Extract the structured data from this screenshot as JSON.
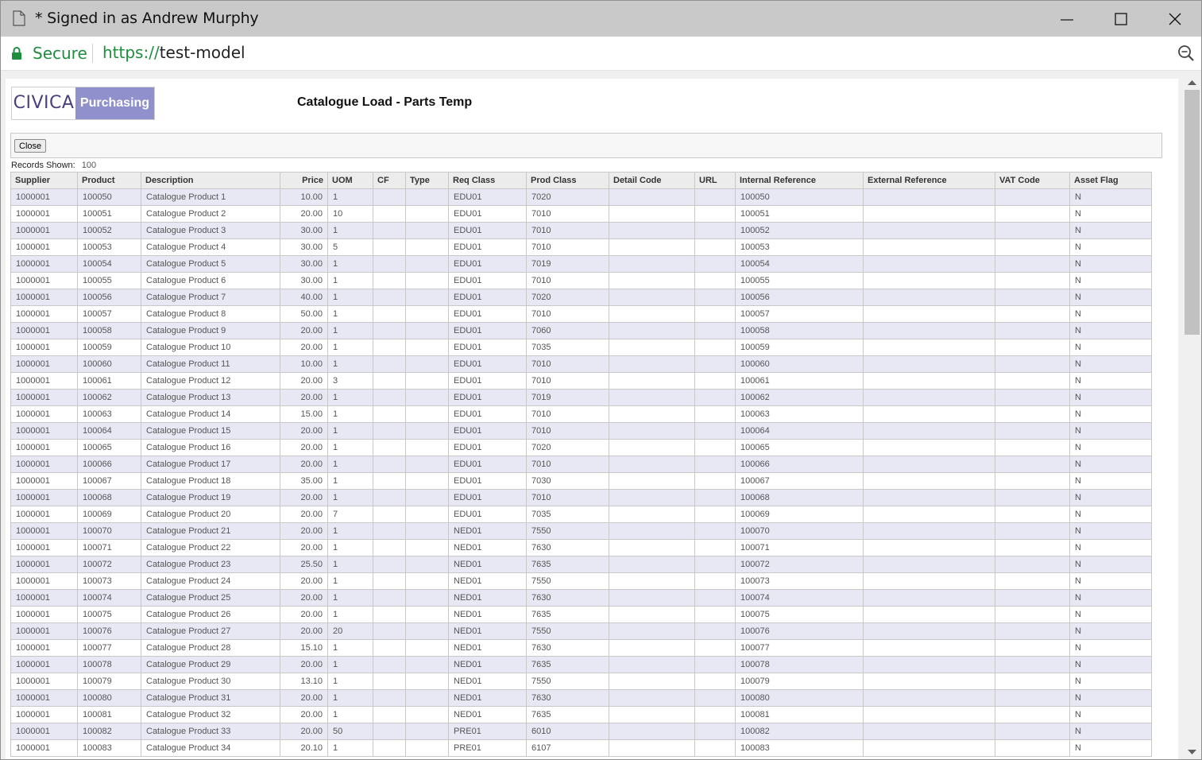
{
  "window": {
    "title": "* Signed in as Andrew Murphy",
    "icons": {
      "doc": "document-icon",
      "min": "minimize-icon",
      "max": "maximize-icon",
      "close": "close-icon"
    }
  },
  "address": {
    "secure_label": "Secure",
    "url_protocol": "https://",
    "url_host": "test-model",
    "icons": {
      "lock": "lock-icon",
      "zoom": "zoom-icon"
    }
  },
  "logo": {
    "brand": "CIVICA",
    "product": "Purchasing"
  },
  "page": {
    "title": "Catalogue Load - Parts Temp"
  },
  "toolbar": {
    "close_label": "Close"
  },
  "records": {
    "label": "Records Shown:",
    "count": "100"
  },
  "colors": {
    "row_alt": "#e8e8f5",
    "logo_purple": "#9090cc",
    "secure_green": "#1e8e3e"
  },
  "table": {
    "columns": [
      "Supplier",
      "Product",
      "Description",
      "Price",
      "UOM",
      "CF",
      "Type",
      "Req Class",
      "Prod Class",
      "Detail Code",
      "URL",
      "Internal Reference",
      "External Reference",
      "VAT Code",
      "Asset Flag"
    ],
    "rows": [
      [
        "1000001",
        "100050",
        "Catalogue Product 1",
        "10.00",
        "1",
        "",
        "",
        "EDU01",
        "7020",
        "",
        "",
        "100050",
        "",
        "",
        "N"
      ],
      [
        "1000001",
        "100051",
        "Catalogue Product 2",
        "20.00",
        "10",
        "",
        "",
        "EDU01",
        "7010",
        "",
        "",
        "100051",
        "",
        "",
        "N"
      ],
      [
        "1000001",
        "100052",
        "Catalogue Product 3",
        "30.00",
        "1",
        "",
        "",
        "EDU01",
        "7010",
        "",
        "",
        "100052",
        "",
        "",
        "N"
      ],
      [
        "1000001",
        "100053",
        "Catalogue Product 4",
        "30.00",
        "5",
        "",
        "",
        "EDU01",
        "7010",
        "",
        "",
        "100053",
        "",
        "",
        "N"
      ],
      [
        "1000001",
        "100054",
        "Catalogue Product 5",
        "30.00",
        "1",
        "",
        "",
        "EDU01",
        "7019",
        "",
        "",
        "100054",
        "",
        "",
        "N"
      ],
      [
        "1000001",
        "100055",
        "Catalogue Product 6",
        "30.00",
        "1",
        "",
        "",
        "EDU01",
        "7010",
        "",
        "",
        "100055",
        "",
        "",
        "N"
      ],
      [
        "1000001",
        "100056",
        "Catalogue Product 7",
        "40.00",
        "1",
        "",
        "",
        "EDU01",
        "7020",
        "",
        "",
        "100056",
        "",
        "",
        "N"
      ],
      [
        "1000001",
        "100057",
        "Catalogue Product 8",
        "50.00",
        "1",
        "",
        "",
        "EDU01",
        "7010",
        "",
        "",
        "100057",
        "",
        "",
        "N"
      ],
      [
        "1000001",
        "100058",
        "Catalogue Product 9",
        "20.00",
        "1",
        "",
        "",
        "EDU01",
        "7060",
        "",
        "",
        "100058",
        "",
        "",
        "N"
      ],
      [
        "1000001",
        "100059",
        "Catalogue Product 10",
        "20.00",
        "1",
        "",
        "",
        "EDU01",
        "7035",
        "",
        "",
        "100059",
        "",
        "",
        "N"
      ],
      [
        "1000001",
        "100060",
        "Catalogue Product 11",
        "10.00",
        "1",
        "",
        "",
        "EDU01",
        "7010",
        "",
        "",
        "100060",
        "",
        "",
        "N"
      ],
      [
        "1000001",
        "100061",
        "Catalogue Product 12",
        "20.00",
        "3",
        "",
        "",
        "EDU01",
        "7010",
        "",
        "",
        "100061",
        "",
        "",
        "N"
      ],
      [
        "1000001",
        "100062",
        "Catalogue Product 13",
        "20.00",
        "1",
        "",
        "",
        "EDU01",
        "7019",
        "",
        "",
        "100062",
        "",
        "",
        "N"
      ],
      [
        "1000001",
        "100063",
        "Catalogue Product 14",
        "15.00",
        "1",
        "",
        "",
        "EDU01",
        "7010",
        "",
        "",
        "100063",
        "",
        "",
        "N"
      ],
      [
        "1000001",
        "100064",
        "Catalogue Product 15",
        "20.00",
        "1",
        "",
        "",
        "EDU01",
        "7010",
        "",
        "",
        "100064",
        "",
        "",
        "N"
      ],
      [
        "1000001",
        "100065",
        "Catalogue Product 16",
        "20.00",
        "1",
        "",
        "",
        "EDU01",
        "7020",
        "",
        "",
        "100065",
        "",
        "",
        "N"
      ],
      [
        "1000001",
        "100066",
        "Catalogue Product 17",
        "20.00",
        "1",
        "",
        "",
        "EDU01",
        "7010",
        "",
        "",
        "100066",
        "",
        "",
        "N"
      ],
      [
        "1000001",
        "100067",
        "Catalogue Product 18",
        "35.00",
        "1",
        "",
        "",
        "EDU01",
        "7030",
        "",
        "",
        "100067",
        "",
        "",
        "N"
      ],
      [
        "1000001",
        "100068",
        "Catalogue Product 19",
        "20.00",
        "1",
        "",
        "",
        "EDU01",
        "7010",
        "",
        "",
        "100068",
        "",
        "",
        "N"
      ],
      [
        "1000001",
        "100069",
        "Catalogue Product 20",
        "20.00",
        "7",
        "",
        "",
        "EDU01",
        "7035",
        "",
        "",
        "100069",
        "",
        "",
        "N"
      ],
      [
        "1000001",
        "100070",
        "Catalogue Product 21",
        "20.00",
        "1",
        "",
        "",
        "NED01",
        "7550",
        "",
        "",
        "100070",
        "",
        "",
        "N"
      ],
      [
        "1000001",
        "100071",
        "Catalogue Product 22",
        "20.00",
        "1",
        "",
        "",
        "NED01",
        "7630",
        "",
        "",
        "100071",
        "",
        "",
        "N"
      ],
      [
        "1000001",
        "100072",
        "Catalogue Product 23",
        "25.50",
        "1",
        "",
        "",
        "NED01",
        "7635",
        "",
        "",
        "100072",
        "",
        "",
        "N"
      ],
      [
        "1000001",
        "100073",
        "Catalogue Product 24",
        "20.00",
        "1",
        "",
        "",
        "NED01",
        "7550",
        "",
        "",
        "100073",
        "",
        "",
        "N"
      ],
      [
        "1000001",
        "100074",
        "Catalogue Product 25",
        "20.00",
        "1",
        "",
        "",
        "NED01",
        "7630",
        "",
        "",
        "100074",
        "",
        "",
        "N"
      ],
      [
        "1000001",
        "100075",
        "Catalogue Product 26",
        "20.00",
        "1",
        "",
        "",
        "NED01",
        "7635",
        "",
        "",
        "100075",
        "",
        "",
        "N"
      ],
      [
        "1000001",
        "100076",
        "Catalogue Product 27",
        "20.00",
        "20",
        "",
        "",
        "NED01",
        "7550",
        "",
        "",
        "100076",
        "",
        "",
        "N"
      ],
      [
        "1000001",
        "100077",
        "Catalogue Product 28",
        "15.10",
        "1",
        "",
        "",
        "NED01",
        "7630",
        "",
        "",
        "100077",
        "",
        "",
        "N"
      ],
      [
        "1000001",
        "100078",
        "Catalogue Product 29",
        "20.00",
        "1",
        "",
        "",
        "NED01",
        "7635",
        "",
        "",
        "100078",
        "",
        "",
        "N"
      ],
      [
        "1000001",
        "100079",
        "Catalogue Product 30",
        "13.10",
        "1",
        "",
        "",
        "NED01",
        "7550",
        "",
        "",
        "100079",
        "",
        "",
        "N"
      ],
      [
        "1000001",
        "100080",
        "Catalogue Product 31",
        "20.00",
        "1",
        "",
        "",
        "NED01",
        "7630",
        "",
        "",
        "100080",
        "",
        "",
        "N"
      ],
      [
        "1000001",
        "100081",
        "Catalogue Product 32",
        "20.00",
        "1",
        "",
        "",
        "NED01",
        "7635",
        "",
        "",
        "100081",
        "",
        "",
        "N"
      ],
      [
        "1000001",
        "100082",
        "Catalogue Product 33",
        "20.00",
        "50",
        "",
        "",
        "PRE01",
        "6010",
        "",
        "",
        "100082",
        "",
        "",
        "N"
      ],
      [
        "1000001",
        "100083",
        "Catalogue Product 34",
        "20.10",
        "1",
        "",
        "",
        "PRE01",
        "6107",
        "",
        "",
        "100083",
        "",
        "",
        "N"
      ]
    ]
  }
}
